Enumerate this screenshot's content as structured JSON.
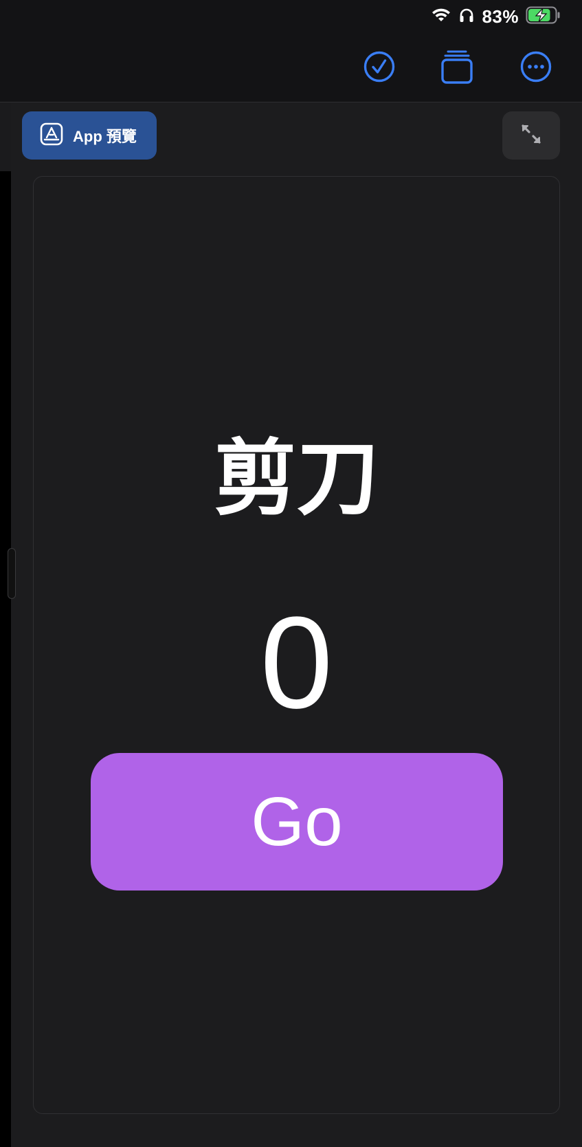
{
  "status_bar": {
    "battery_percent": "83%",
    "battery_level": 0.83
  },
  "toolbar": {
    "done_icon": "checkmark-circle-icon",
    "tabs_icon": "stacked-cards-icon",
    "more_icon": "ellipsis-circle-icon",
    "accent_color": "#3a7ef5"
  },
  "preview": {
    "button_label": "App 預覽",
    "icon": "app-store-icon"
  },
  "app": {
    "choice_label": "剪刀",
    "score": "0",
    "go_label": "Go",
    "go_color": "#b063e8"
  }
}
